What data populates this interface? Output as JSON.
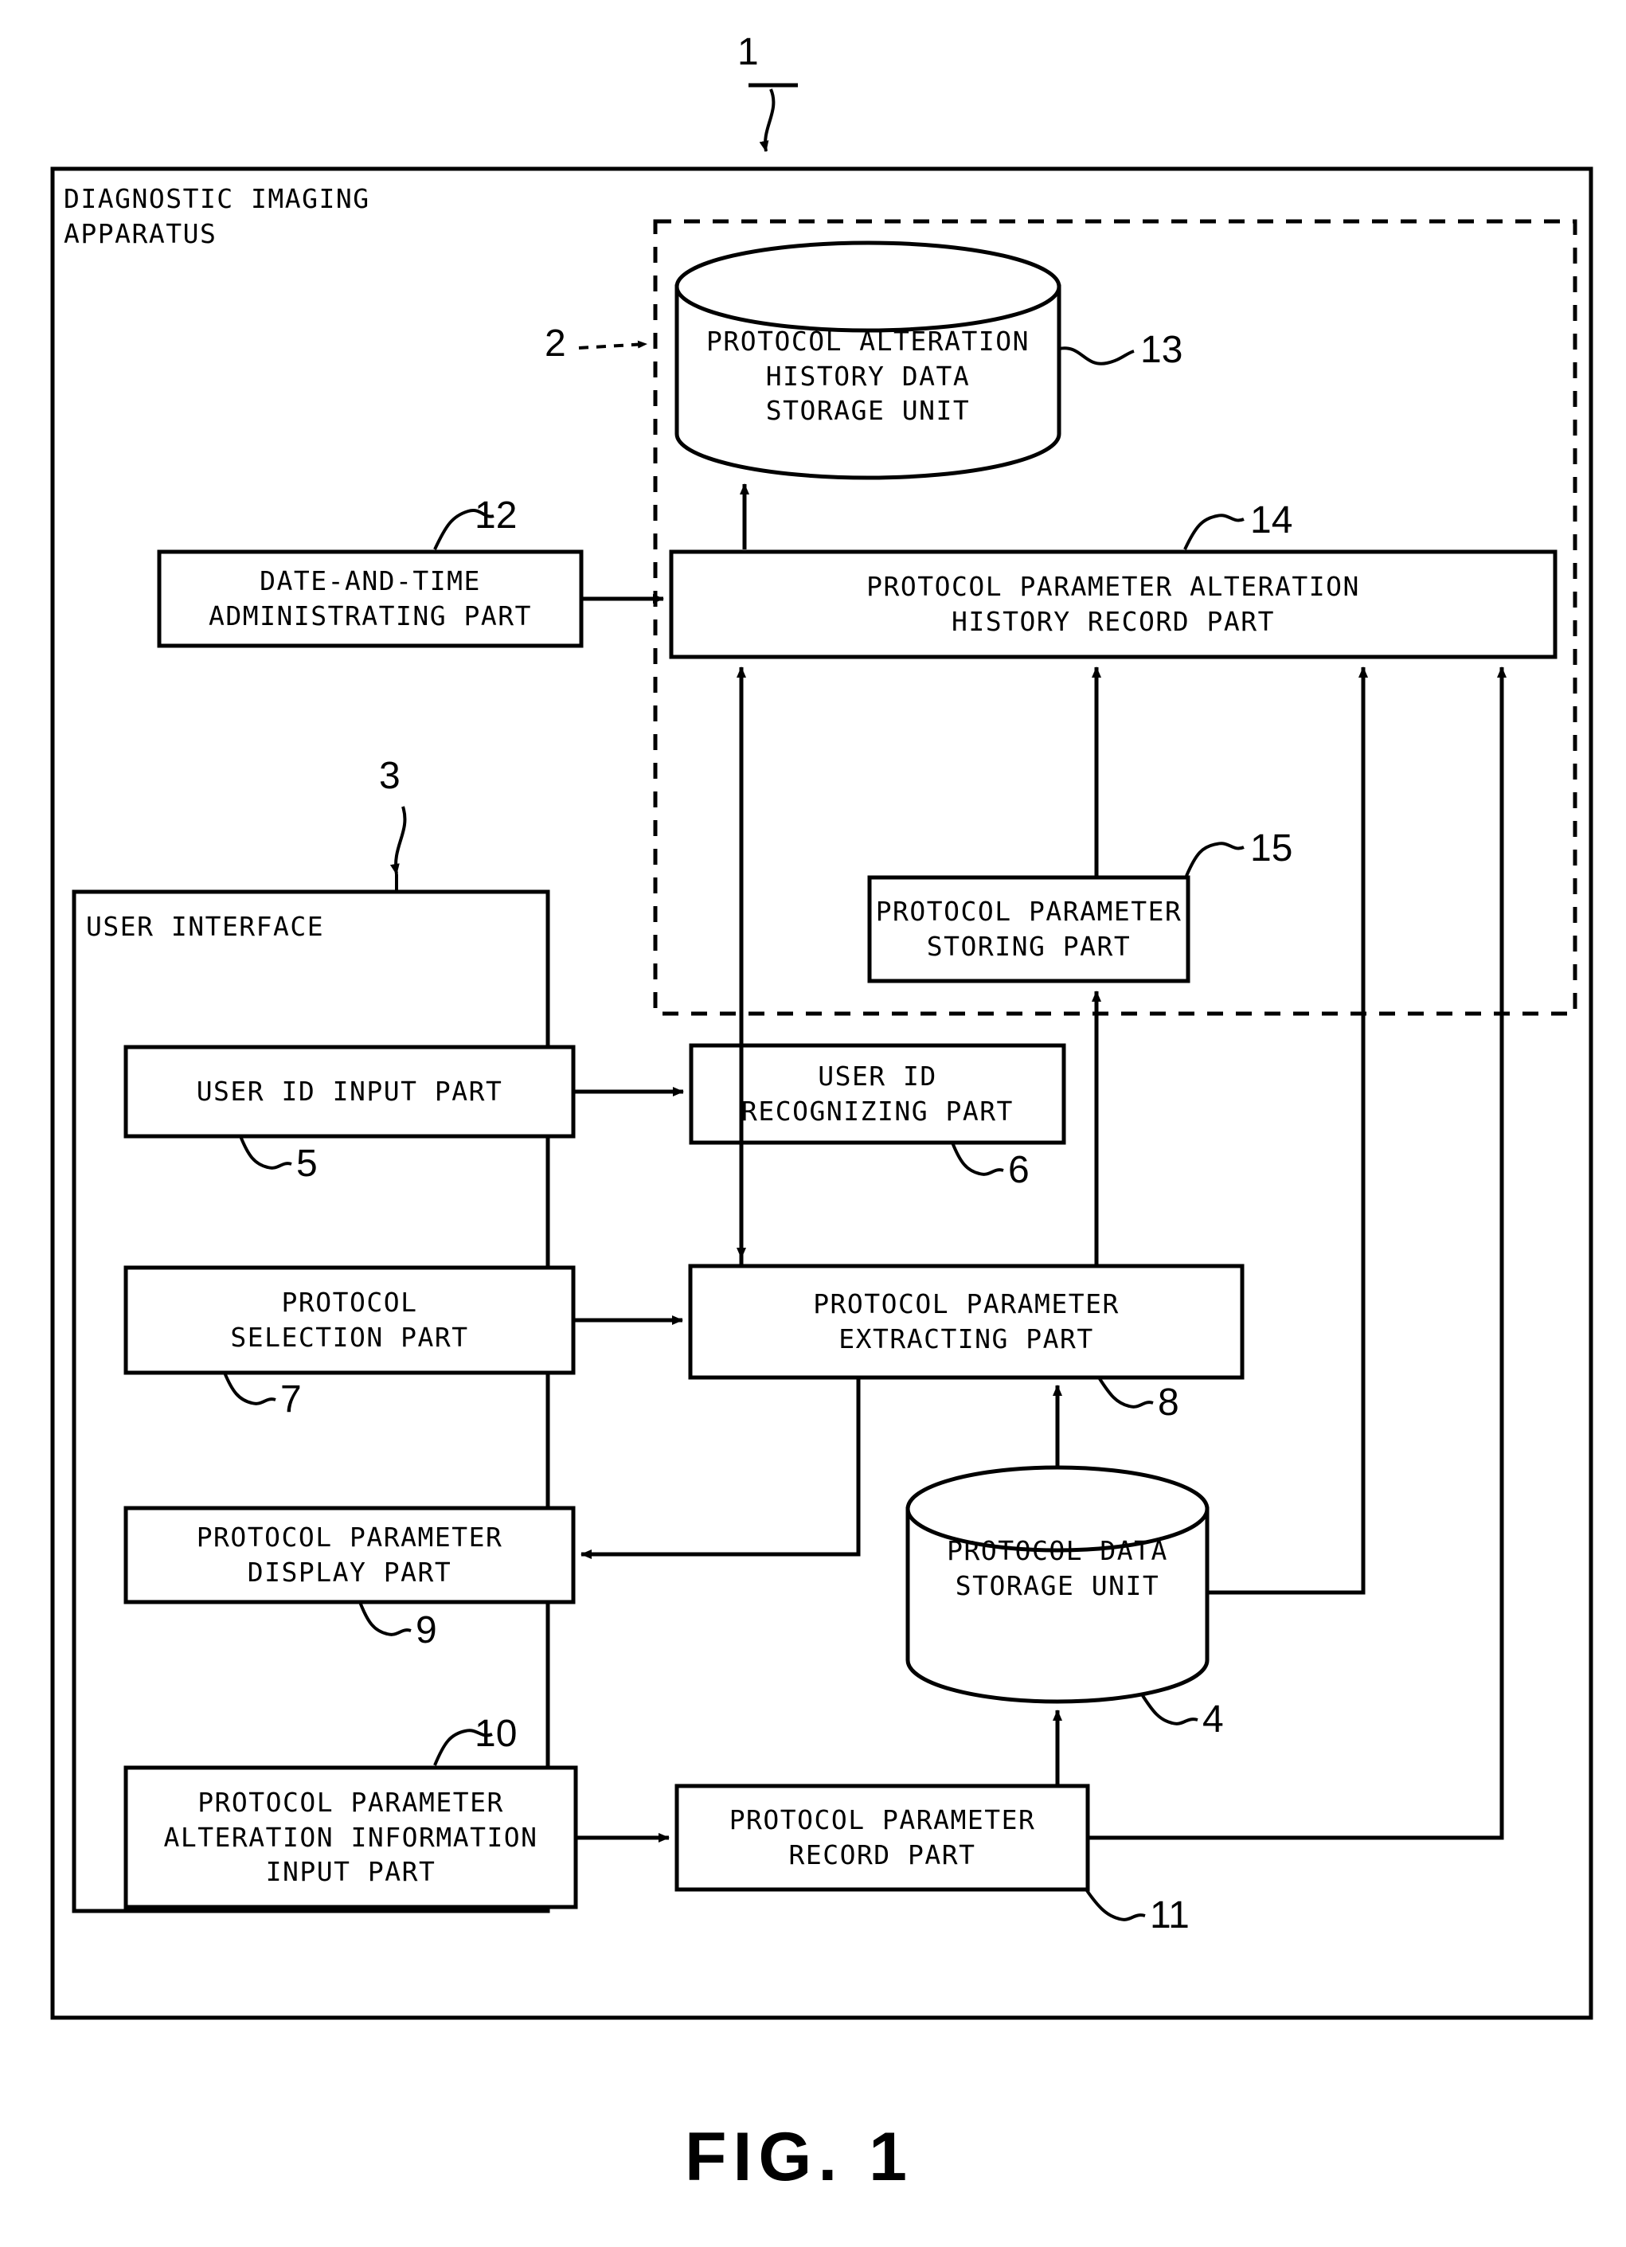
{
  "figure": {
    "caption": "FIG. 1",
    "outer_container_label": "DIAGNOSTIC IMAGING\nAPPARATUS",
    "outer_container_ref": "1",
    "dashed_group_ref": "2",
    "user_interface_label": "USER INTERFACE",
    "user_interface_ref": "3"
  },
  "nodes": {
    "protocol_alteration_history_data_storage_unit": {
      "label": "PROTOCOL ALTERATION\nHISTORY DATA\nSTORAGE UNIT",
      "ref": "13",
      "shape": "cylinder"
    },
    "date_and_time_administrating_part": {
      "label": "DATE-AND-TIME\nADMINISTRATING PART",
      "ref": "12",
      "shape": "rectangle"
    },
    "protocol_parameter_alteration_history_record_part": {
      "label": "PROTOCOL PARAMETER ALTERATION\nHISTORY RECORD PART",
      "ref": "14",
      "shape": "rectangle"
    },
    "protocol_parameter_storing_part": {
      "label": "PROTOCOL PARAMETER\nSTORING PART",
      "ref": "15",
      "shape": "rectangle"
    },
    "user_id_input_part": {
      "label": "USER ID INPUT PART",
      "ref": "5",
      "shape": "rectangle"
    },
    "user_id_recognizing_part": {
      "label": "USER ID\nRECOGNIZING PART",
      "ref": "6",
      "shape": "rectangle"
    },
    "protocol_selection_part": {
      "label": "PROTOCOL\nSELECTION PART",
      "ref": "7",
      "shape": "rectangle"
    },
    "protocol_parameter_extracting_part": {
      "label": "PROTOCOL PARAMETER\nEXTRACTING PART",
      "ref": "8",
      "shape": "rectangle"
    },
    "protocol_parameter_display_part": {
      "label": "PROTOCOL PARAMETER\nDISPLAY PART",
      "ref": "9",
      "shape": "rectangle"
    },
    "protocol_parameter_alteration_information_input_part": {
      "label": "PROTOCOL PARAMETER\nALTERATION INFORMATION\nINPUT PART",
      "ref": "10",
      "shape": "rectangle"
    },
    "protocol_data_storage_unit": {
      "label": "PROTOCOL DATA\nSTORAGE UNIT",
      "ref": "4",
      "shape": "cylinder"
    },
    "protocol_parameter_record_part": {
      "label": "PROTOCOL PARAMETER\nRECORD PART",
      "ref": "11",
      "shape": "rectangle"
    }
  },
  "colors": {
    "stroke": "#000000",
    "background": "#ffffff"
  }
}
